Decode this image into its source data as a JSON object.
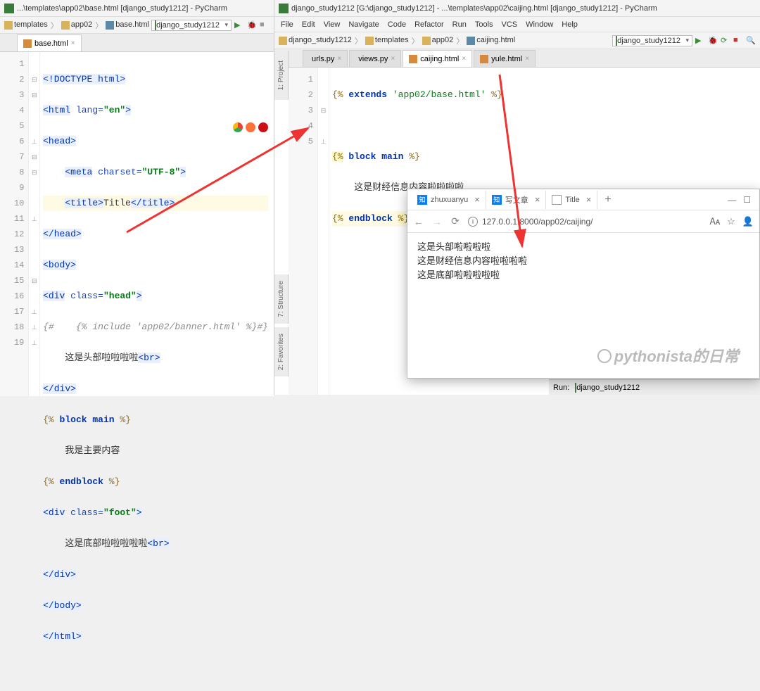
{
  "left_window": {
    "title": "...\\templates\\app02\\base.html [django_study1212] - PyCharm",
    "breadcrumb": [
      "templates",
      "app02",
      "base.html"
    ],
    "run_config": "django_study1212",
    "tab": "base.html",
    "code": {
      "l1": "<!DOCTYPE html>",
      "l2a": "<html",
      "l2b": "lang=",
      "l2c": "\"en\"",
      "l2d": ">",
      "l3": "<head>",
      "l4a": "<meta",
      "l4b": "charset=",
      "l4c": "\"UTF-8\"",
      "l4d": ">",
      "l5a": "<title>",
      "l5b": "Title",
      "l5c": "</title>",
      "l6": "</head>",
      "l7": "<body>",
      "l8a": "<div",
      "l8b": "class=",
      "l8c": "\"head\"",
      "l8d": ">",
      "l9": "{#    {% include 'app02/banner.html' %}#}",
      "l10a": "这是头部啦啦啦啦",
      "l10b": "<br>",
      "l11": "</div>",
      "l12a": "{%",
      "l12b": "block main",
      "l12c": "%}",
      "l13": "我是主要内容",
      "l14a": "{%",
      "l14b": "endblock",
      "l14c": "%}",
      "l15a": "<div",
      "l15b": "class=",
      "l15c": "\"foot\"",
      "l15d": ">",
      "l16a": "这是底部啦啦啦啦啦",
      "l16b": "<br>",
      "l17": "</div>",
      "l18": "</body>",
      "l19": "</html>"
    }
  },
  "right_window": {
    "title": "django_study1212 [G:\\django_study1212] - ...\\templates\\app02\\caijing.html [django_study1212] - PyCharm",
    "menu": [
      "File",
      "Edit",
      "View",
      "Navigate",
      "Code",
      "Refactor",
      "Run",
      "Tools",
      "VCS",
      "Window",
      "Help"
    ],
    "breadcrumb": [
      "django_study1212",
      "templates",
      "app02",
      "caijing.html"
    ],
    "run_config": "django_study1212",
    "tabs": [
      "urls.py",
      "views.py",
      "caijing.html",
      "yule.html"
    ],
    "active_tab": "caijing.html",
    "code": {
      "l1a": "{%",
      "l1b": "extends",
      "l1c": "'app02/base.html'",
      "l1d": "%}",
      "l3a": "{%",
      "l3b": "block main",
      "l3c": "%}",
      "l4": "这是财经信息内容啦啦啦啦",
      "l5a": "{%",
      "l5b": "endblock",
      "l5c": "%}"
    },
    "run_tab": {
      "label": "Run:",
      "config": "django_study1212"
    },
    "side_labels": {
      "project": "1: Project",
      "structure": "7: Structure",
      "favorites": "2: Favorites"
    }
  },
  "browser": {
    "tabs": [
      {
        "name": "zhuxuanyu",
        "icon": "知"
      },
      {
        "name": "写文章",
        "icon": "知"
      },
      {
        "name": "Title",
        "icon": "doc"
      }
    ],
    "active_tab_index": 2,
    "url": "127.0.0.1:8000/app02/caijing/",
    "content": [
      "这是头部啦啦啦啦",
      "这是财经信息内容啦啦啦啦",
      "这是底部啦啦啦啦啦"
    ]
  },
  "watermark": "pythonista的日常"
}
